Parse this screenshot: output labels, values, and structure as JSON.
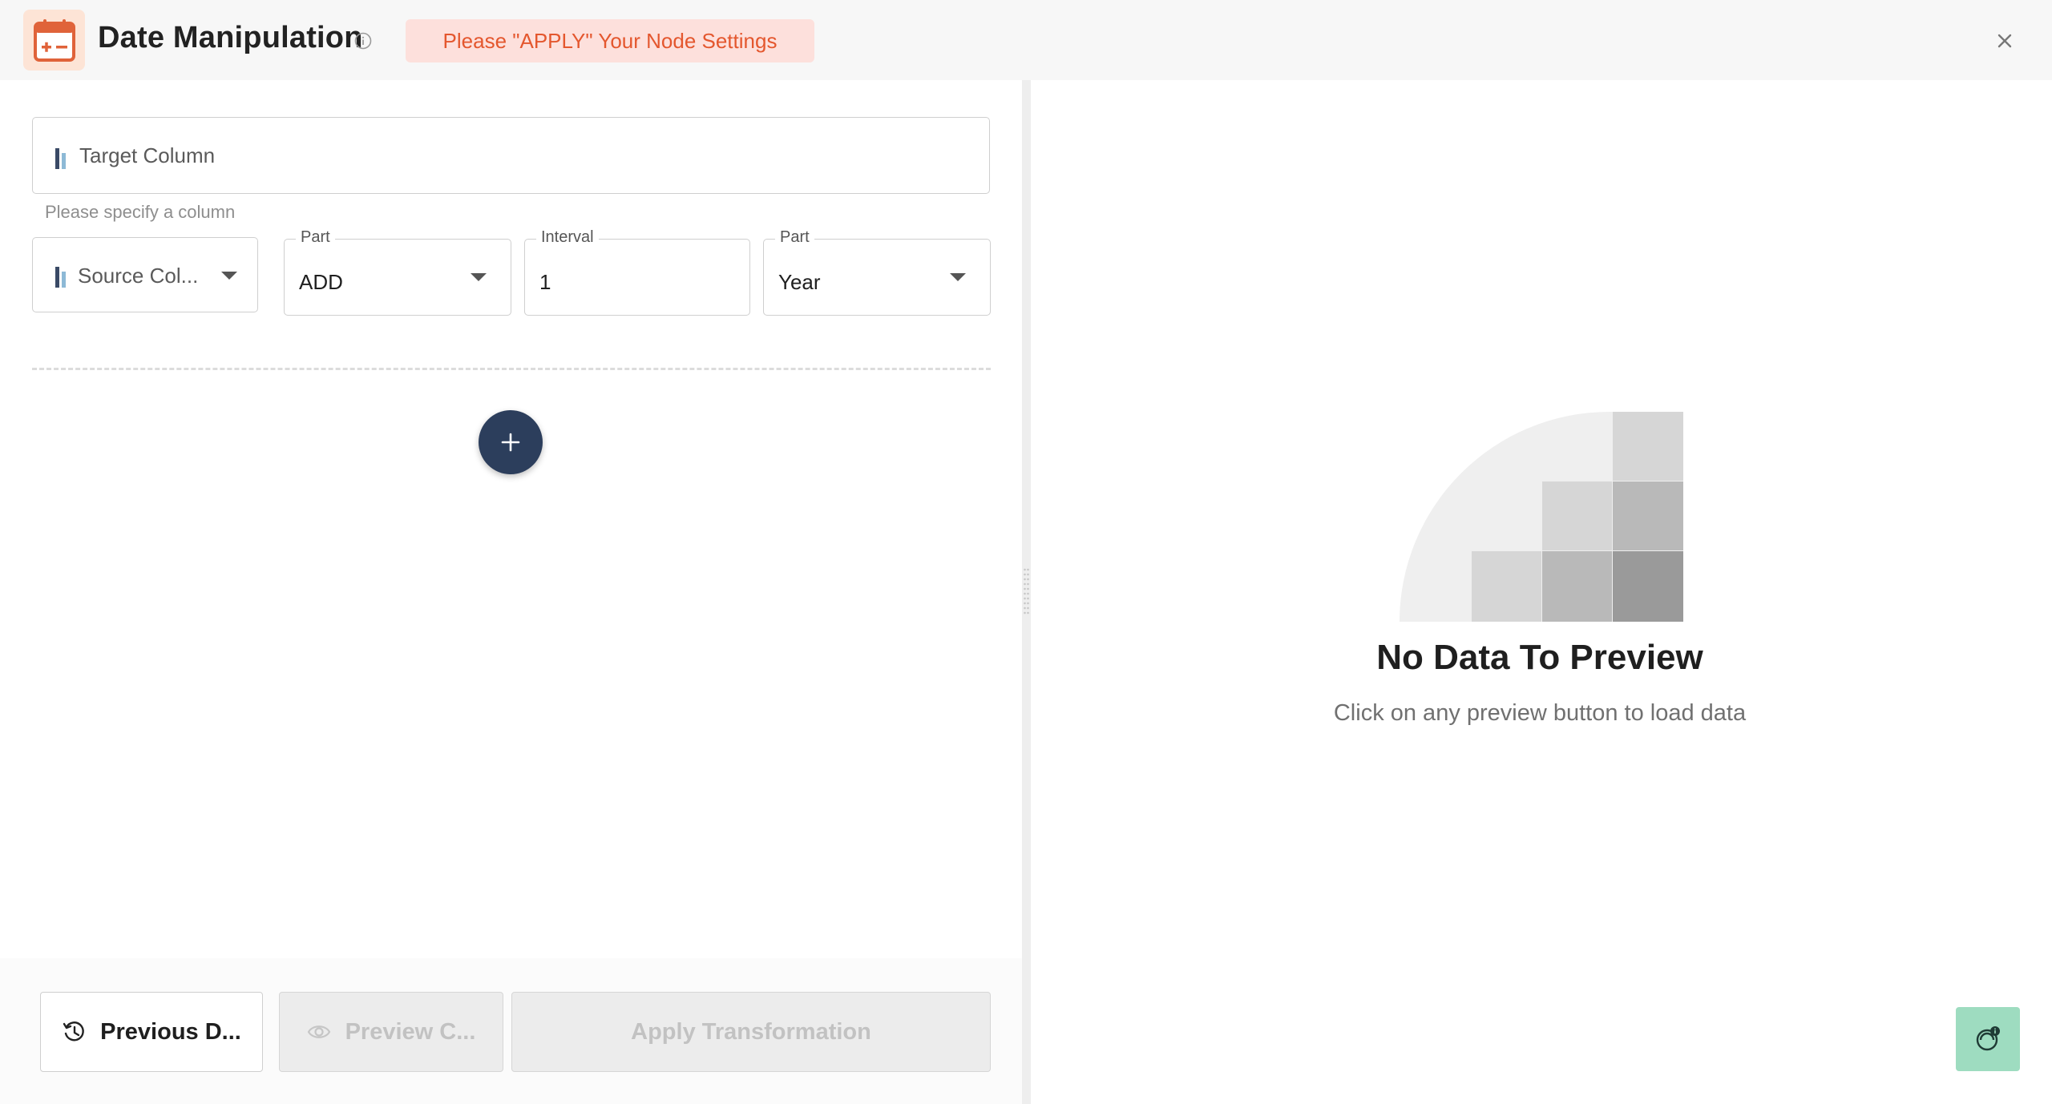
{
  "header": {
    "title": "Date Manipulation",
    "alert": "Please \"APPLY\" Your Node Settings",
    "icons": {
      "app": "calendar-plus-minus-icon",
      "info": "info-icon",
      "close": "close-icon"
    }
  },
  "form": {
    "target_column": {
      "placeholder": "Target Column",
      "helper": "Please specify a column"
    },
    "source_column": {
      "placeholder": "Source Col..."
    },
    "operation": {
      "label": "Part",
      "value": "ADD"
    },
    "interval": {
      "label": "Interval",
      "value": "1"
    },
    "unit": {
      "label": "Part",
      "value": "Year"
    },
    "add_button_icon": "plus-icon"
  },
  "footer": {
    "previous_label": "Previous D...",
    "preview_label": "Preview C...",
    "apply_label": "Apply Transformation"
  },
  "preview": {
    "title": "No Data To Preview",
    "subtitle": "Click on any preview button to load data"
  },
  "colors": {
    "accent": "#e4572e",
    "alert_bg": "#fde0dc",
    "add_button": "#2c3e5c",
    "help_button": "#9edcc0"
  }
}
